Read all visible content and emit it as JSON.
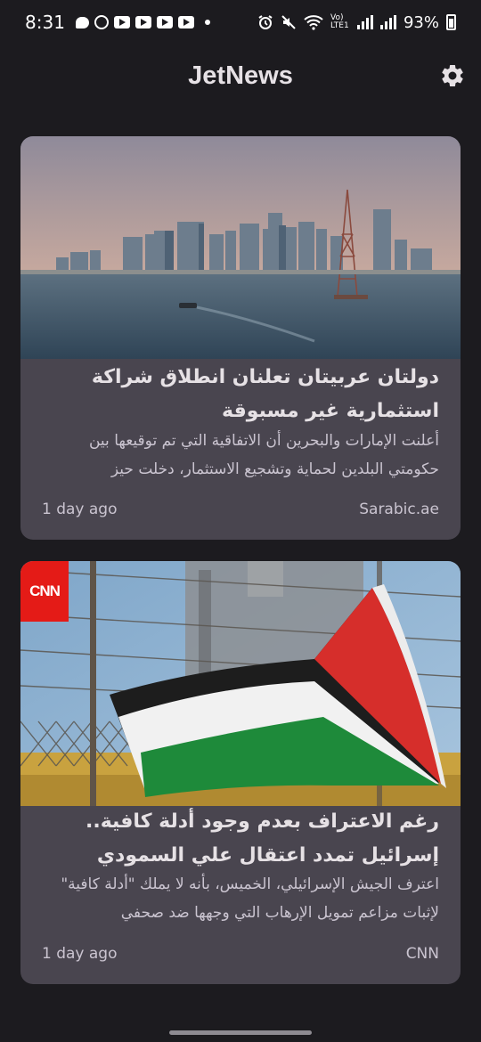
{
  "status_bar": {
    "time": "8:31",
    "battery": "93%",
    "network": "Vo) LTE1"
  },
  "app_bar": {
    "title": "JetNews",
    "settings_icon": "gear-icon"
  },
  "articles": [
    {
      "title": "دولتان عربيتان تعلنان انطلاق شراكة استثمارية غير مسبوقة",
      "summary": "أعلنت الإمارات والبحرين أن الاتفاقية التي تم توقيعها بين حكومتي البلدين لحماية وتشجيع الاستثمار، دخلت حيز",
      "time_ago": "1 day ago",
      "source": "Sarabic.ae"
    },
    {
      "title": "رغم الاعتراف بعدم وجود أدلة كافية.. إسرائيل تمدد اعتقال علي السمودي",
      "summary": "اعترف الجيش الإسرائيلي، الخميس، بأنه لا يملك \"أدلة كافية\" لإثبات مزاعم تمويل الإرهاب التي وجهها ضد صحفي",
      "time_ago": "1 day ago",
      "source": "CNN",
      "logo_text": "CNN"
    }
  ],
  "colors": {
    "background": "#1c1b1f",
    "card": "#49454f",
    "cnn_red": "#e41b17"
  }
}
